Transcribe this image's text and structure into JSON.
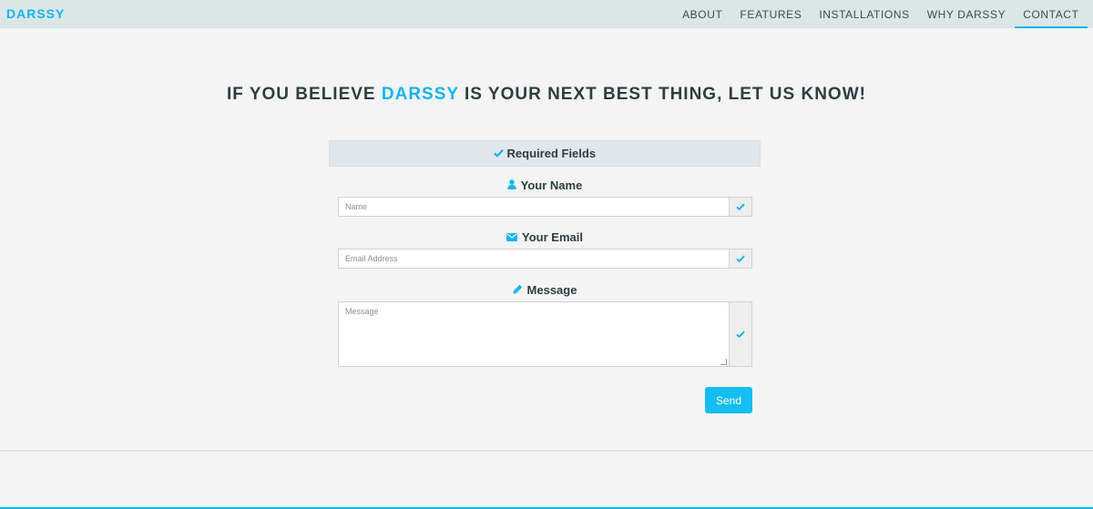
{
  "navbar": {
    "brand": "DARSSY",
    "items": [
      {
        "label": "ABOUT"
      },
      {
        "label": "FEATURES"
      },
      {
        "label": "INSTALLATIONS"
      },
      {
        "label": "WHY DARSSY"
      },
      {
        "label": "CONTACT"
      }
    ],
    "active": "CONTACT"
  },
  "headline": {
    "before": "IF YOU BELIEVE ",
    "brand": "DARSSY",
    "after": " IS YOUR NEXT BEST THING, LET US KNOW!"
  },
  "form": {
    "required_label": "Required Fields",
    "name": {
      "label": "Your Name",
      "placeholder": "Name",
      "value": ""
    },
    "email": {
      "label": "Your Email",
      "placeholder": "Email Address",
      "value": ""
    },
    "message": {
      "label": "Message",
      "placeholder": "Message",
      "value": ""
    },
    "send_label": "Send"
  },
  "icons": {
    "check": "check-icon",
    "user": "user-icon",
    "envelope": "envelope-icon",
    "pencil": "pencil-icon"
  },
  "colors": {
    "accent": "#14b4ec",
    "button": "#14bdf2",
    "navbar_bg": "#dbe6e6",
    "page_bg": "#f4f4f4",
    "text": "#2c3e40"
  }
}
